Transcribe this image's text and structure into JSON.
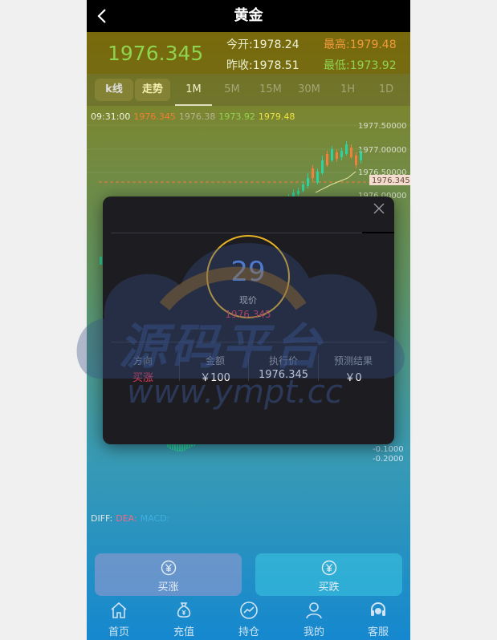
{
  "header": {
    "title": "黄金"
  },
  "quote": {
    "current": "1976.345",
    "open_label": "今开:",
    "open_value": "1978.24",
    "high_label": "最高:",
    "high_value": "1979.48",
    "prev_close_label": "昨收:",
    "prev_close_value": "1978.51",
    "low_label": "最低:",
    "low_value": "1973.92"
  },
  "tabs": {
    "kline": "k线",
    "trend": "走势",
    "periods": [
      "1M",
      "5M",
      "15M",
      "30M",
      "1H",
      "1D"
    ],
    "active_period": "1M"
  },
  "chart_info": {
    "time": "09:31:00",
    "a": "1976.345",
    "b": "1976.38",
    "c": "1973.92",
    "d": "1979.48"
  },
  "chart_data": {
    "type": "candlestick",
    "y_ticks": [
      "1977.50000",
      "1977.00000",
      "1976.50000",
      "1976.00000"
    ],
    "last_price_label": "1976.345",
    "macd_ticks": [
      "-0.1000",
      "-0.2000"
    ],
    "colors": {
      "up": "#2dd4a0",
      "down": "#f08040",
      "ma": "#e8e8a0"
    }
  },
  "macd_legend": {
    "diff": "DIFF:",
    "dea": "DEA:",
    "macd": "MACD:"
  },
  "modal": {
    "countdown": "29",
    "price_label": "现价",
    "price": "1976.345",
    "direction_label": "方向",
    "direction": "买涨",
    "amount_label": "金额",
    "amount": "￥100",
    "exec_label": "执行价",
    "exec_price": "1976.345",
    "result_label": "预测结果",
    "result": "￥0"
  },
  "actions": {
    "buy_up": "买涨",
    "buy_down": "买跌"
  },
  "nav": [
    "首页",
    "充值",
    "持仓",
    "我的",
    "客服"
  ],
  "watermark": {
    "text": "源码平台",
    "url": "www.ympt.cc"
  }
}
